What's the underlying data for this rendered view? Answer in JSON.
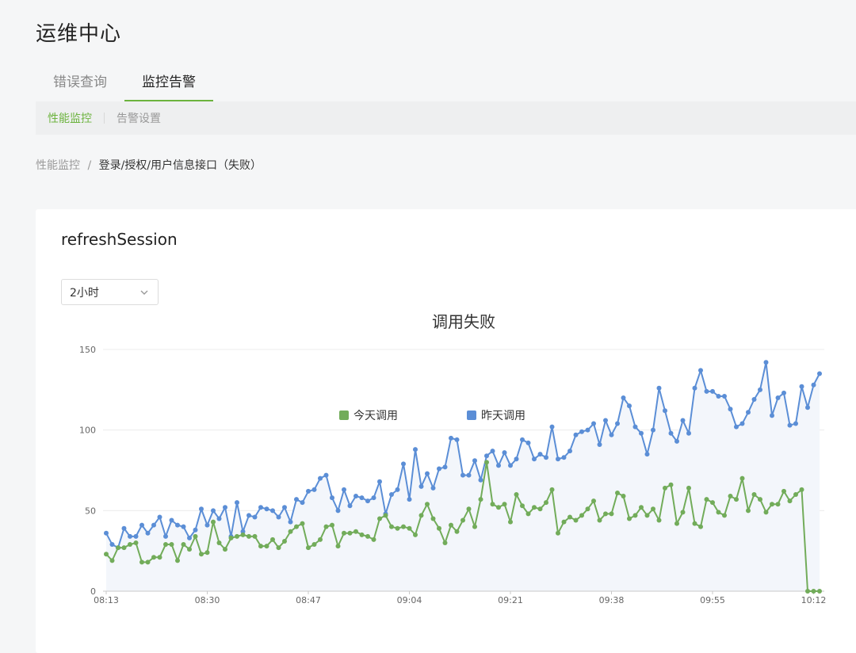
{
  "page": {
    "title": "运维中心"
  },
  "tabs": [
    {
      "label": "错误查询",
      "active": false
    },
    {
      "label": "监控告警",
      "active": true
    }
  ],
  "subnav": [
    {
      "label": "性能监控",
      "active": true
    },
    {
      "label": "告警设置",
      "active": false
    }
  ],
  "breadcrumb": {
    "parent": "性能监控",
    "separator": "/",
    "current": "登录/授权/用户信息接口（失败）"
  },
  "card": {
    "title": "refreshSession",
    "range_select": {
      "value": "2小时"
    }
  },
  "colors": {
    "accent": "#6cb33e",
    "today": "#72ac5a",
    "yesterday": "#5b8ed6"
  },
  "chart_data": {
    "type": "line",
    "title": "调用失败",
    "y_ticks": [
      "0",
      "50",
      "100",
      "150"
    ],
    "ylim": [
      0,
      150
    ],
    "x_ticks": [
      "08:13",
      "08:30",
      "08:47",
      "09:04",
      "09:21",
      "09:38",
      "09:55",
      "10:12"
    ],
    "x_tick_index": [
      0,
      17,
      34,
      51,
      68,
      85,
      102,
      119
    ],
    "grid": true,
    "legend_position": "bottom",
    "series": [
      {
        "name": "今天调用",
        "color": "#72ac5a",
        "values": [
          23,
          19,
          27,
          27,
          29,
          30,
          18,
          18,
          21,
          21,
          29,
          29,
          19,
          29,
          26,
          34,
          23,
          24,
          43,
          30,
          26,
          33,
          34,
          35,
          34,
          34,
          28,
          28,
          32,
          27,
          31,
          37,
          40,
          42,
          27,
          29,
          32,
          40,
          41,
          28,
          36,
          36,
          37,
          35,
          34,
          32,
          45,
          47,
          40,
          39,
          40,
          39,
          35,
          47,
          54,
          45,
          39,
          30,
          41,
          37,
          44,
          51,
          40,
          57,
          80,
          54,
          52,
          54,
          43,
          60,
          53,
          48,
          52,
          51,
          55,
          63,
          36,
          43,
          46,
          44,
          47,
          51,
          56,
          44,
          48,
          48,
          61,
          59,
          45,
          47,
          52,
          47,
          51,
          44,
          64,
          66,
          42,
          49,
          64,
          42,
          40,
          57,
          55,
          49,
          47,
          59,
          57,
          70,
          50,
          60,
          57,
          49,
          54,
          54,
          62,
          56,
          60,
          63,
          0,
          0,
          0
        ]
      },
      {
        "name": "昨天调用",
        "color": "#5b8ed6",
        "values": [
          36,
          29,
          27,
          39,
          34,
          34,
          41,
          36,
          41,
          46,
          34,
          44,
          41,
          40,
          33,
          38,
          51,
          41,
          50,
          45,
          52,
          34,
          55,
          37,
          47,
          46,
          52,
          51,
          50,
          46,
          52,
          43,
          57,
          55,
          62,
          63,
          70,
          72,
          58,
          50,
          63,
          53,
          59,
          58,
          56,
          58,
          68,
          48,
          60,
          63,
          79,
          57,
          88,
          65,
          73,
          64,
          76,
          77,
          95,
          94,
          72,
          72,
          81,
          69,
          84,
          87,
          78,
          86,
          78,
          82,
          94,
          92,
          82,
          85,
          83,
          102,
          82,
          83,
          87,
          97,
          99,
          100,
          104,
          91,
          106,
          97,
          104,
          120,
          115,
          102,
          98,
          85,
          100,
          126,
          112,
          98,
          93,
          106,
          98,
          126,
          137,
          124,
          124,
          121,
          121,
          113,
          102,
          104,
          111,
          119,
          125,
          142,
          109,
          120,
          123,
          103,
          104,
          127,
          114,
          128,
          135
        ]
      }
    ]
  }
}
